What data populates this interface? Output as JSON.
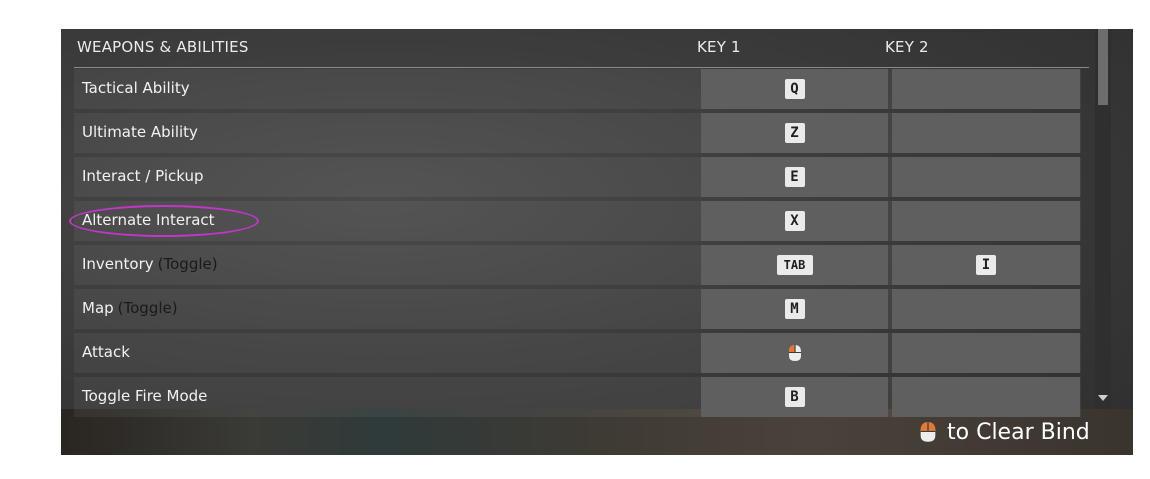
{
  "header": {
    "section_title": "WEAPONS & ABILITIES",
    "key1_label": "KEY 1",
    "key2_label": "KEY 2"
  },
  "rows": [
    {
      "label": "Tactical Ability",
      "toggle": "",
      "key1": "Q",
      "key2": ""
    },
    {
      "label": "Ultimate Ability",
      "toggle": "",
      "key1": "Z",
      "key2": ""
    },
    {
      "label": "Interact / Pickup",
      "toggle": "",
      "key1": "E",
      "key2": ""
    },
    {
      "label": "Alternate Interact",
      "toggle": "",
      "key1": "X",
      "key2": ""
    },
    {
      "label": "Inventory",
      "toggle": "(Toggle)",
      "key1": "TAB",
      "key2": "I"
    },
    {
      "label": "Map",
      "toggle": "(Toggle)",
      "key1": "M",
      "key2": ""
    },
    {
      "label": "Attack",
      "toggle": "",
      "key1": "mouse-left-icon",
      "key2": ""
    },
    {
      "label": "Toggle Fire Mode",
      "toggle": "",
      "key1": "B",
      "key2": ""
    }
  ],
  "highlighted_row": "Alternate Interact",
  "footer": {
    "hint_icon": "mouse-right-icon",
    "hint_text": "to Clear Bind"
  },
  "colors": {
    "highlight": "#c236c9",
    "mouse_accent": "#e8782a"
  }
}
